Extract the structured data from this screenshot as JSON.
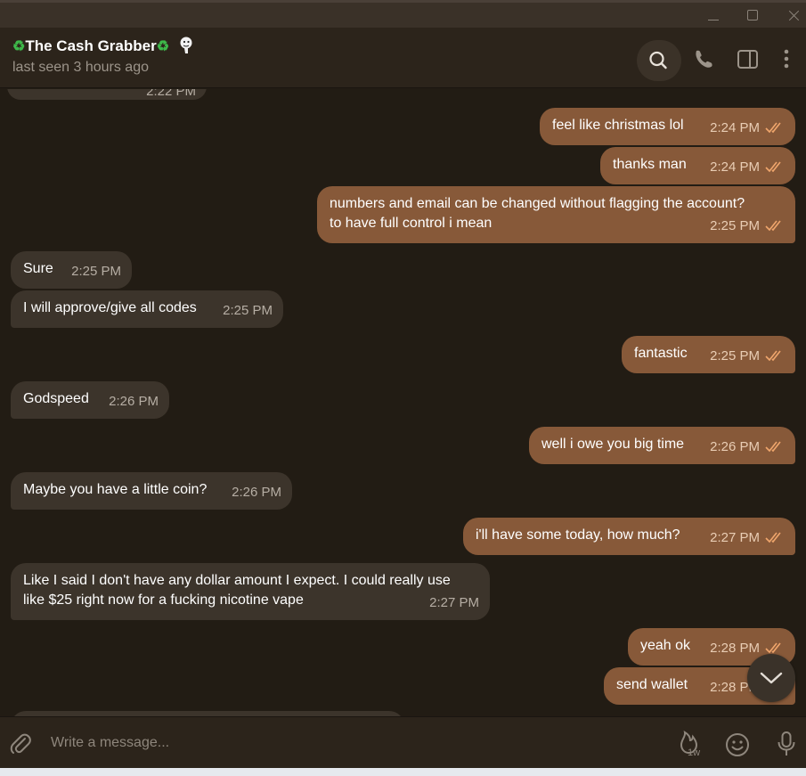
{
  "window": {
    "controls": [
      "minimize-icon",
      "maximize-icon",
      "close-icon"
    ]
  },
  "header": {
    "title": "The Cash Grabber",
    "title_emoji": "♻",
    "status": "last seen 3 hours ago",
    "actions": [
      "search-icon",
      "phone-icon",
      "side-panel-icon",
      "more-icon"
    ]
  },
  "messages": [
    {
      "dir": "in",
      "text": "",
      "time": "2:22 PM"
    },
    {
      "dir": "out",
      "text": "feel like christmas lol",
      "time": "2:24 PM"
    },
    {
      "dir": "out",
      "text": "thanks man",
      "time": "2:24 PM"
    },
    {
      "dir": "out",
      "text": "numbers and email can be changed without flagging the account?\nto have full control i mean",
      "time": "2:25 PM"
    },
    {
      "dir": "in",
      "text": "Sure",
      "time": "2:25 PM"
    },
    {
      "dir": "in",
      "text": "I will approve/give all codes",
      "time": "2:25 PM"
    },
    {
      "dir": "out",
      "text": "fantastic",
      "time": "2:25 PM"
    },
    {
      "dir": "in",
      "text": "Godspeed",
      "time": "2:26 PM"
    },
    {
      "dir": "out",
      "text": "well i owe you big time",
      "time": "2:26 PM"
    },
    {
      "dir": "in",
      "text": "Maybe you have a little coin?",
      "time": "2:26 PM"
    },
    {
      "dir": "out",
      "text": "i'll have some today, how much?",
      "time": "2:27 PM"
    },
    {
      "dir": "in",
      "text": "Like I said I don't have any dollar amount I expect. I could really use\nlike $25 right now for a fucking nicotine vape",
      "time": "2:27 PM"
    },
    {
      "dir": "out",
      "text": "yeah ok",
      "time": "2:28 PM"
    },
    {
      "dir": "out",
      "text": "send wallet",
      "time": "2:28 PM"
    }
  ],
  "composer": {
    "placeholder": "Write a message...",
    "timer_label": "1w"
  },
  "colors": {
    "background": "#221c14",
    "bubble_in": "#3c342b",
    "bubble_out": "#875939",
    "read_ticks": "#f0a66c"
  }
}
